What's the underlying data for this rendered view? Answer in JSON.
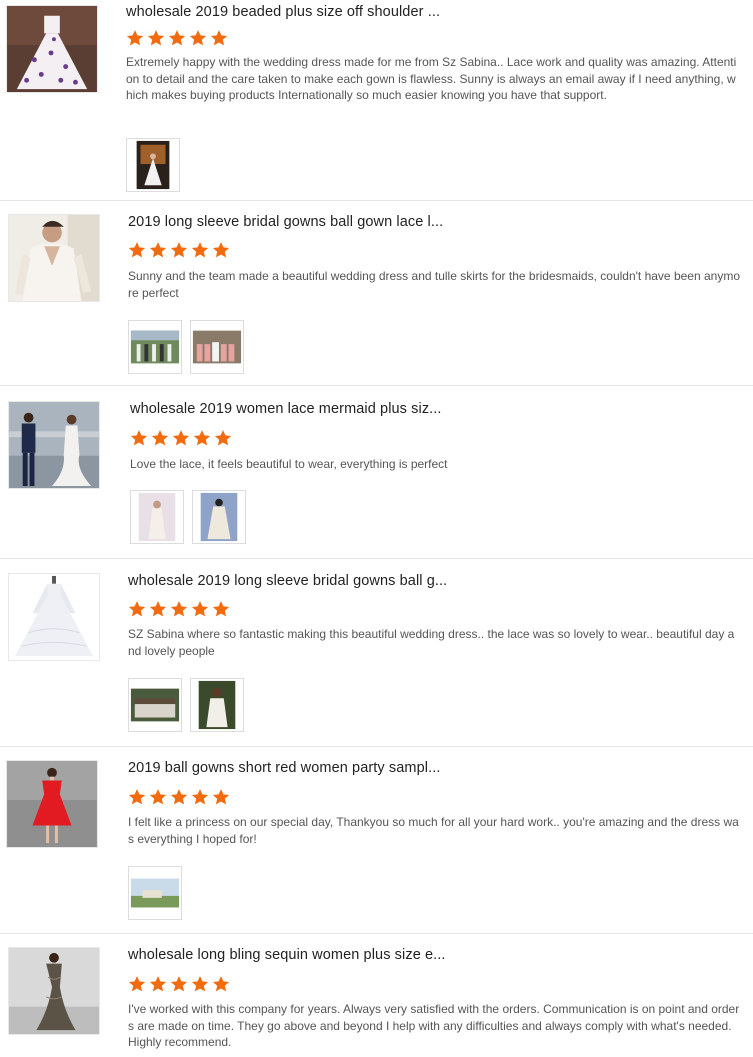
{
  "reviews": [
    {
      "title": "wholesale 2019 beaded plus size off shoulder ...",
      "rating": 5,
      "text": "Extremely happy with the wedding dress made for me from Sz Sabina.. Lace work and quality was amazing. Attention to detail and the care taken to make each gown is flawless. Sunny is always an email away if I need anything,  which makes buying products Internationally so much easier knowing you have that support.",
      "photo_count": 1
    },
    {
      "title": "2019 long sleeve bridal gowns ball gown lace l...",
      "rating": 5,
      "text": "Sunny and the team made a beautiful wedding dress and tulle skirts for the bridesmaids, couldn't have been anymore perfect",
      "photo_count": 2
    },
    {
      "title": "wholesale 2019 women lace mermaid plus siz...",
      "rating": 5,
      "text": "Love the lace, it feels beautiful to wear,  everything is perfect",
      "photo_count": 2
    },
    {
      "title": "wholesale 2019 long sleeve bridal gowns ball g...",
      "rating": 5,
      "text": "SZ Sabina where so fantastic making this beautiful wedding dress.. the lace was so lovely to wear.. beautiful day and lovely people",
      "photo_count": 2
    },
    {
      "title": "2019 ball gowns short red women party sampl...",
      "rating": 5,
      "text": "I felt like a princess on our special day, Thankyou so much for all your hard work.. you're amazing and the dress was everything I hoped for!",
      "photo_count": 1
    },
    {
      "title": "wholesale long bling sequin women plus size e...",
      "rating": 5,
      "text": "I've worked with this company for years. Always very satisfied with the orders. Communication is on point and orders are made on time. They go above and beyond I help with any difficulties and always comply with what's needed. Highly recommend.",
      "photo_count": 0
    }
  ],
  "colors": {
    "star": "#f26b0f",
    "divider": "#e6e6e6",
    "title": "#222222",
    "text": "#555555"
  }
}
